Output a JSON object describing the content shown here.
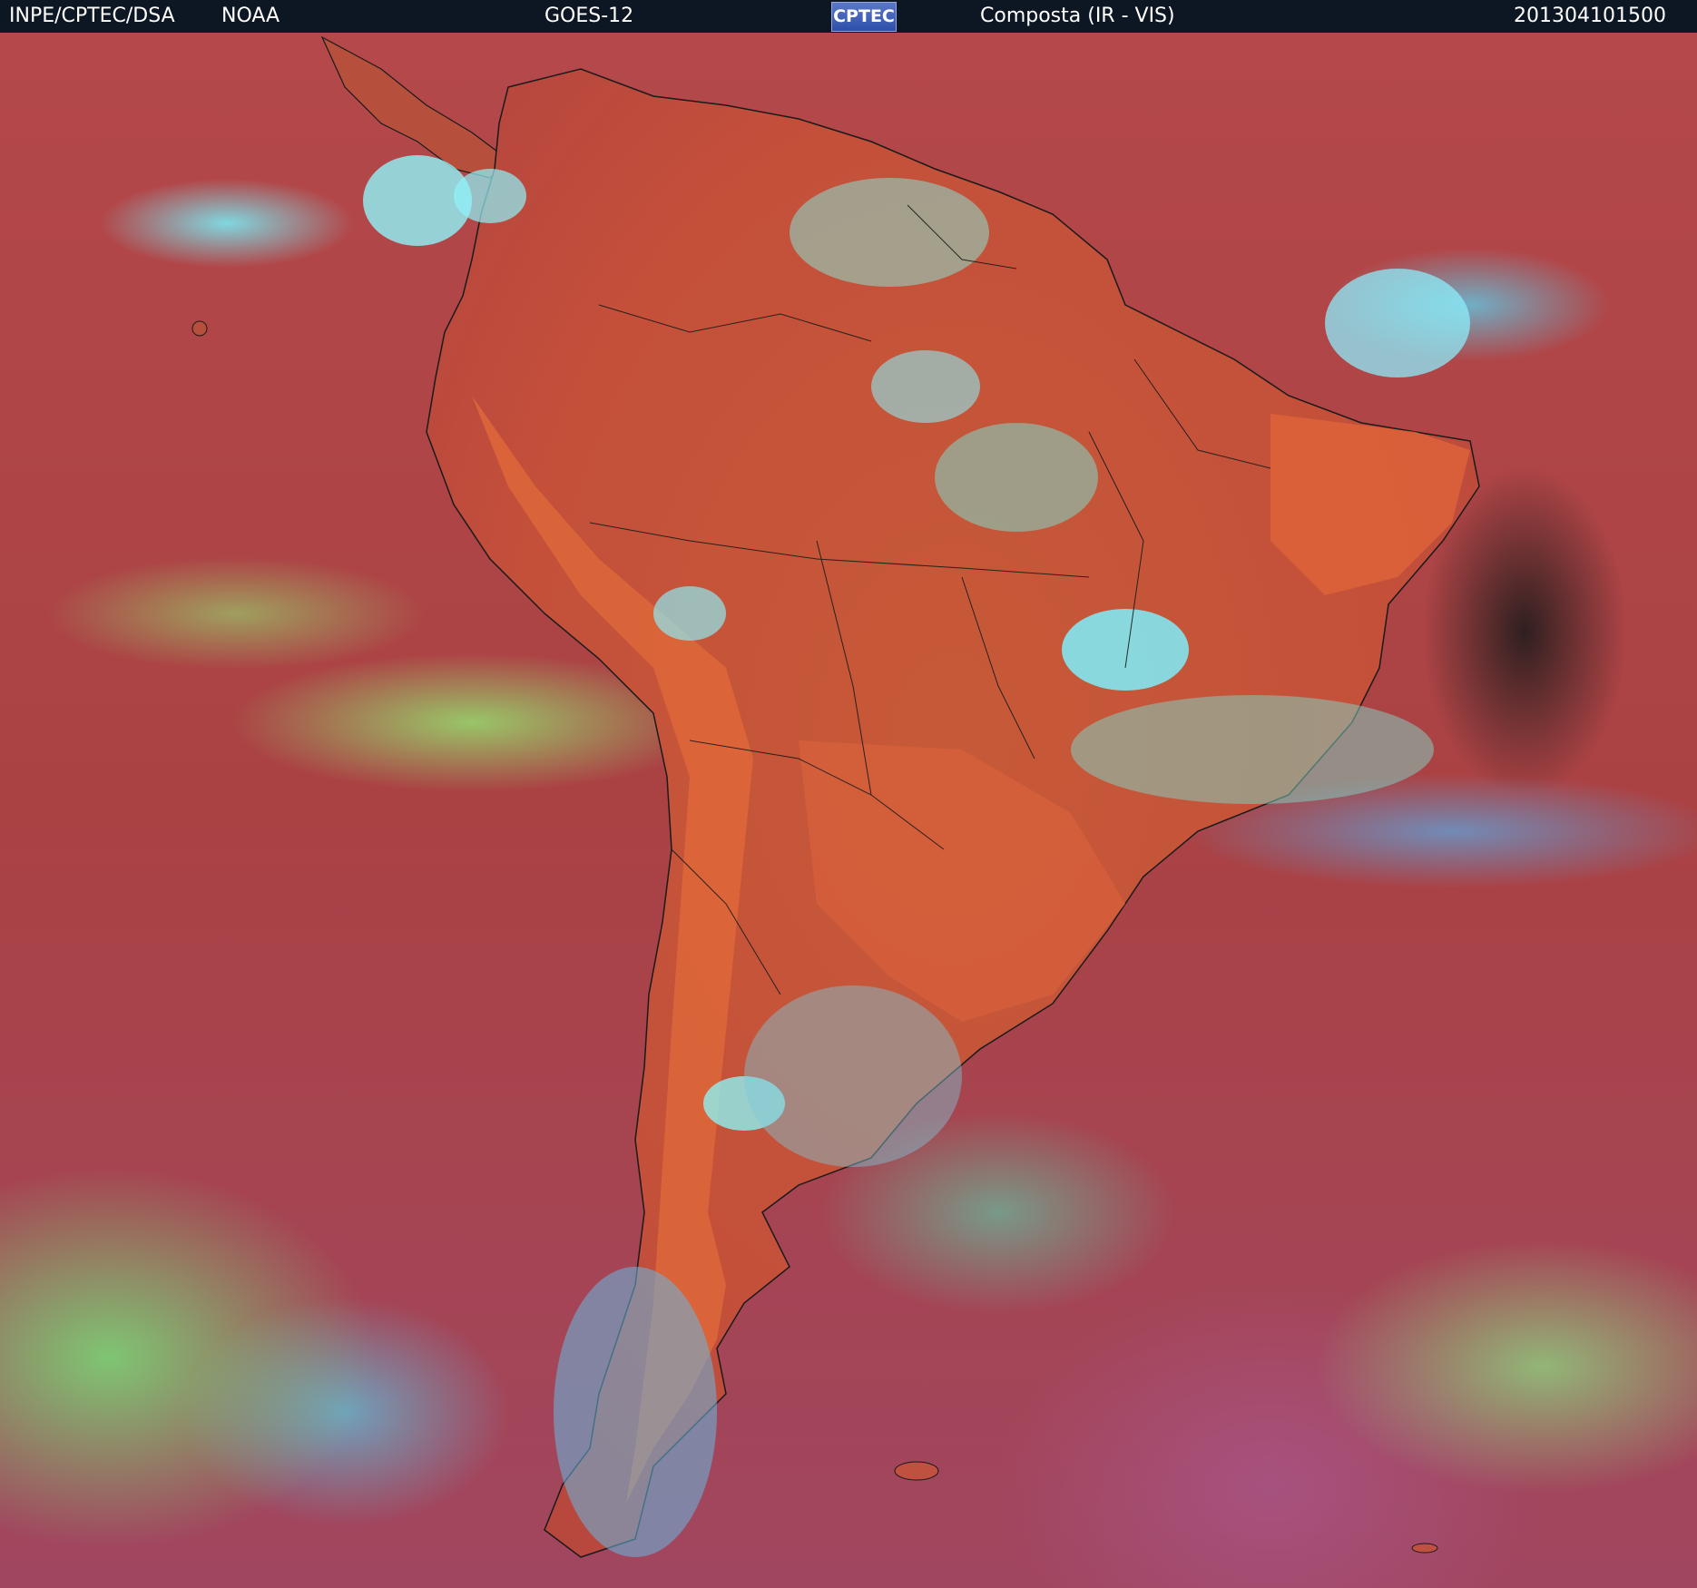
{
  "header": {
    "agency": "INPE/CPTEC/DSA",
    "source": "NOAA",
    "satellite": "GOES-12",
    "logo_text": "CPTEC",
    "product": "Composta (IR - VIS)",
    "timestamp": "201304101500"
  },
  "colors": {
    "header_bg": "#0d1723",
    "ocean": "#b4484a",
    "land": "#c9583c",
    "cloud_green": "#96dc6e",
    "cloud_cyan": "#6ef0fa"
  }
}
